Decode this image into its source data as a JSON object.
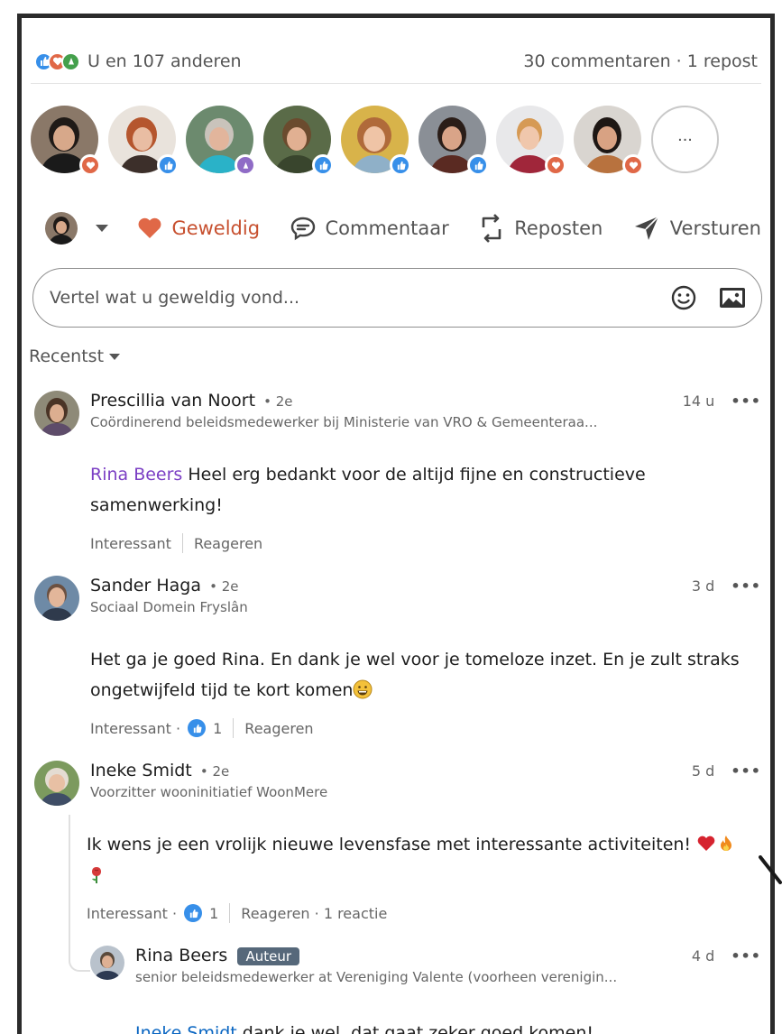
{
  "social": {
    "reactions_label": "U en 107 anderen",
    "counts_label": "30 commentaren · 1 repost",
    "reaction_colors": [
      "#378fe9",
      "#e06847",
      "#44a04c"
    ]
  },
  "reactors": {
    "more_label": "...",
    "items": [
      {
        "name": "reactor-1",
        "reaction": "love"
      },
      {
        "name": "reactor-2",
        "reaction": "like"
      },
      {
        "name": "reactor-3",
        "reaction": "celebrate"
      },
      {
        "name": "reactor-4",
        "reaction": "like"
      },
      {
        "name": "reactor-5",
        "reaction": "like"
      },
      {
        "name": "reactor-6",
        "reaction": "like"
      },
      {
        "name": "reactor-7",
        "reaction": "love"
      },
      {
        "name": "reactor-8",
        "reaction": "love"
      }
    ]
  },
  "actions": {
    "geweldig": "Geweldig",
    "commentaar": "Commentaar",
    "reposten": "Reposten",
    "versturen": "Versturen",
    "active_color": "#c7502f"
  },
  "comment_input": {
    "placeholder": "Vertel wat u geweldig vond..."
  },
  "sort": {
    "label": "Recentst"
  },
  "comments": [
    {
      "name": "Prescillia van Noort",
      "degree": "• 2e",
      "subtitle": "Coördinerend beleidsmedewerker bij Ministerie van VRO & Gemeenteraa...",
      "time": "14 u",
      "mention": "Rina Beers",
      "text_line1": " Heel erg bedankt voor de altijd fijne en constructieve",
      "text_line2": "samenwerking!",
      "like_label": "Interessant",
      "reply_label": "Reageren"
    },
    {
      "name": "Sander Haga",
      "degree": "• 2e",
      "subtitle": "Sociaal Domein Fryslân",
      "time": "3 d",
      "text_line1": "Het ga je goed Rina. En dank je wel voor je tomeloze inzet. En je zult straks",
      "text_line2": "ongetwijfeld tijd te kort komen",
      "like_label": "Interessant ·",
      "like_count": "1",
      "reply_label": "Reageren"
    },
    {
      "name": "Ineke Smidt",
      "degree": "• 2e",
      "subtitle": "Voorzitter wooninitiatief WoonMere",
      "time": "5 d",
      "text_line1": "Ik wens je een vrolijk nieuwe levensfase met interessante activiteiten!",
      "like_label": "Interessant ·",
      "like_count": "1",
      "reply_label": "Reageren · 1 reactie"
    }
  ],
  "reply": {
    "name": "Rina Beers",
    "badge": "Auteur",
    "subtitle": "senior beleidsmedewerker at Vereniging Valente (voorheen verenigin...",
    "time": "4 d",
    "mention": "Ineke Smidt",
    "text": " dank je wel, dat gaat zeker goed komen!"
  },
  "menu_dots": "•••"
}
